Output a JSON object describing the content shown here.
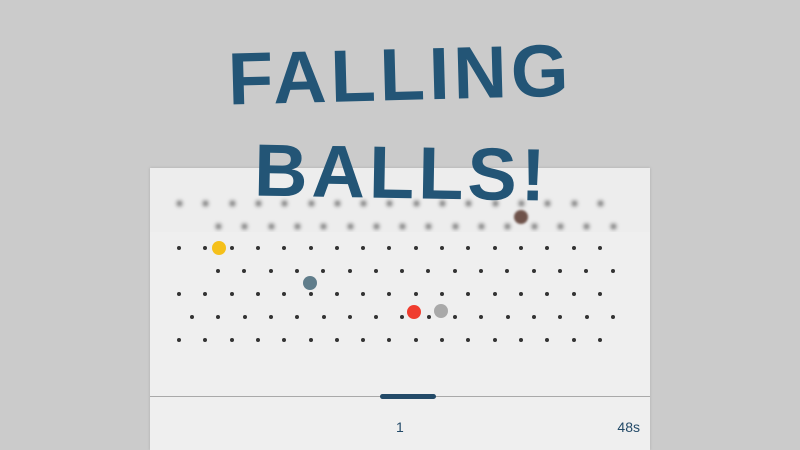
{
  "title": {
    "line1": "FALLING",
    "line2": "BALLS!",
    "color": "#235576"
  },
  "hud": {
    "score": "1",
    "timer": "48s"
  },
  "colors": {
    "background": "#cbcbcb",
    "board": "#efefef",
    "peg": "#333333",
    "paddle": "#234a68"
  },
  "balls": [
    {
      "name": "yellow-ball",
      "color": "#f5c01a"
    },
    {
      "name": "slate-ball",
      "color": "#607d8b"
    },
    {
      "name": "red-ball",
      "color": "#f03c2e"
    },
    {
      "name": "gray-ball",
      "color": "#a9a9a9"
    },
    {
      "name": "brown-ball",
      "color": "#6e524a"
    }
  ]
}
